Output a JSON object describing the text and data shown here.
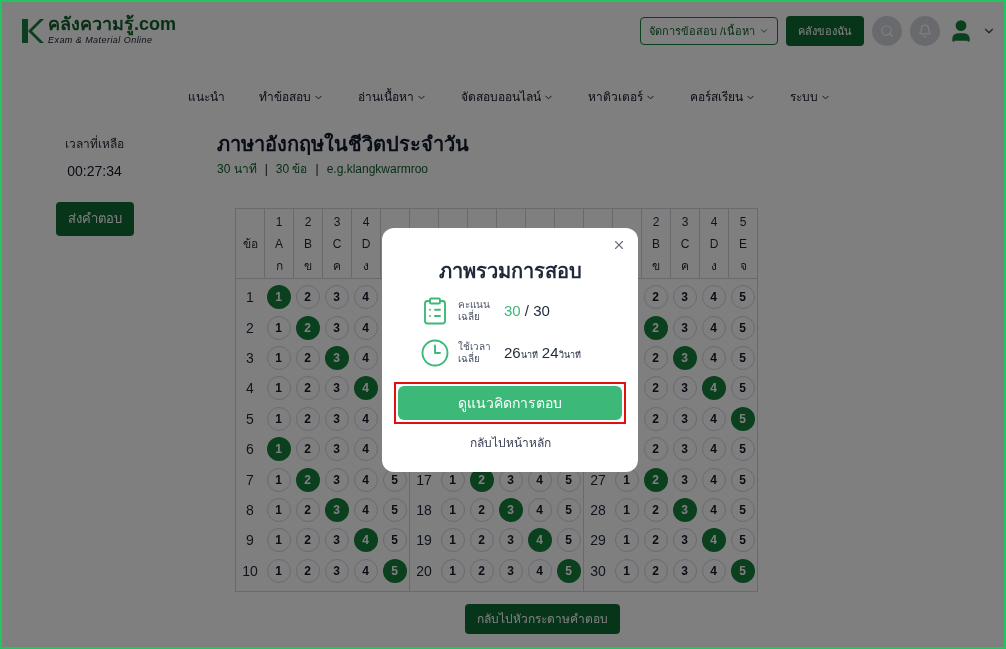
{
  "header": {
    "logo_title": "คลังความรู้.com",
    "logo_subtitle": "Exam & Material Online",
    "manage_menu": "จัดการข้อสอบ /เนื้อหา",
    "my_button": "คลังของฉัน"
  },
  "nav": [
    {
      "label": "แนะนำ",
      "dropdown": false
    },
    {
      "label": "ทำข้อสอบ",
      "dropdown": true
    },
    {
      "label": "อ่านเนื้อหา",
      "dropdown": true
    },
    {
      "label": "จัดสอบออนไลน์",
      "dropdown": true
    },
    {
      "label": "หาติวเตอร์",
      "dropdown": true
    },
    {
      "label": "คอร์สเรียน",
      "dropdown": true
    },
    {
      "label": "ระบบ",
      "dropdown": true
    }
  ],
  "timer": {
    "label": "เวลาที่เหลือ",
    "value": "00:27:34",
    "submit": "ส่งคำตอบ"
  },
  "exam": {
    "title": "ภาษาอังกฤษในชีวิตประจำวัน",
    "meta": [
      "30 นาที",
      "30 ข้อ",
      "e.g.klangkwarmroo"
    ],
    "separator": "|"
  },
  "sheet": {
    "groups": [
      {
        "label": "ข้อ",
        "kind": "left",
        "columns": [
          {
            "number": "1",
            "letter": "A",
            "thai": "ก"
          },
          {
            "number": "2",
            "letter": "B",
            "thai": "ข"
          },
          {
            "number": "3",
            "letter": "C",
            "thai": "ค"
          },
          {
            "number": "4",
            "letter": "D",
            "thai": "ง"
          }
        ],
        "rows": [
          {
            "number": "1",
            "choices": [
              {
                "label": "1",
                "selected": true
              },
              {
                "label": "2",
                "selected": false
              },
              {
                "label": "3",
                "selected": false
              },
              {
                "label": "4",
                "selected": false
              }
            ]
          },
          {
            "number": "2",
            "choices": [
              {
                "label": "1",
                "selected": false
              },
              {
                "label": "2",
                "selected": true
              },
              {
                "label": "3",
                "selected": false
              },
              {
                "label": "4",
                "selected": false
              }
            ]
          },
          {
            "number": "3",
            "choices": [
              {
                "label": "1",
                "selected": false
              },
              {
                "label": "2",
                "selected": false
              },
              {
                "label": "3",
                "selected": true
              },
              {
                "label": "4",
                "selected": false
              }
            ]
          },
          {
            "number": "4",
            "choices": [
              {
                "label": "1",
                "selected": false
              },
              {
                "label": "2",
                "selected": false
              },
              {
                "label": "3",
                "selected": false
              },
              {
                "label": "4",
                "selected": true
              }
            ]
          },
          {
            "number": "5",
            "choices": [
              {
                "label": "1",
                "selected": false
              },
              {
                "label": "2",
                "selected": false
              },
              {
                "label": "3",
                "selected": false
              },
              {
                "label": "4",
                "selected": false
              }
            ]
          },
          {
            "number": "6",
            "choices": [
              {
                "label": "1",
                "selected": true
              },
              {
                "label": "2",
                "selected": false
              },
              {
                "label": "3",
                "selected": false
              },
              {
                "label": "4",
                "selected": false
              }
            ]
          },
          {
            "number": "7",
            "choices": [
              {
                "label": "1",
                "selected": false
              },
              {
                "label": "2",
                "selected": true
              },
              {
                "label": "3",
                "selected": false
              },
              {
                "label": "4",
                "selected": false
              },
              {
                "label": "5",
                "selected": false
              }
            ]
          },
          {
            "number": "8",
            "choices": [
              {
                "label": "1",
                "selected": false
              },
              {
                "label": "2",
                "selected": false
              },
              {
                "label": "3",
                "selected": true
              },
              {
                "label": "4",
                "selected": false
              },
              {
                "label": "5",
                "selected": false
              }
            ]
          },
          {
            "number": "9",
            "choices": [
              {
                "label": "1",
                "selected": false
              },
              {
                "label": "2",
                "selected": false
              },
              {
                "label": "3",
                "selected": false
              },
              {
                "label": "4",
                "selected": true
              },
              {
                "label": "5",
                "selected": false
              }
            ]
          },
          {
            "number": "10",
            "choices": [
              {
                "label": "1",
                "selected": false
              },
              {
                "label": "2",
                "selected": false
              },
              {
                "label": "3",
                "selected": false
              },
              {
                "label": "4",
                "selected": false
              },
              {
                "label": "5",
                "selected": true
              }
            ]
          }
        ]
      },
      {
        "kind": "bottom",
        "rows": [
          {
            "number": "17",
            "choices": [
              {
                "label": "1",
                "selected": false
              },
              {
                "label": "2",
                "selected": true
              },
              {
                "label": "3",
                "selected": false
              },
              {
                "label": "4",
                "selected": false
              },
              {
                "label": "5",
                "selected": false
              }
            ]
          },
          {
            "number": "18",
            "choices": [
              {
                "label": "1",
                "selected": false
              },
              {
                "label": "2",
                "selected": false
              },
              {
                "label": "3",
                "selected": true
              },
              {
                "label": "4",
                "selected": false
              },
              {
                "label": "5",
                "selected": false
              }
            ]
          },
          {
            "number": "19",
            "choices": [
              {
                "label": "1",
                "selected": false
              },
              {
                "label": "2",
                "selected": false
              },
              {
                "label": "3",
                "selected": false
              },
              {
                "label": "4",
                "selected": true
              },
              {
                "label": "5",
                "selected": false
              }
            ]
          },
          {
            "number": "20",
            "choices": [
              {
                "label": "1",
                "selected": false
              },
              {
                "label": "2",
                "selected": false
              },
              {
                "label": "3",
                "selected": false
              },
              {
                "label": "4",
                "selected": false
              },
              {
                "label": "5",
                "selected": true
              }
            ]
          }
        ]
      },
      {
        "kind": "right",
        "columns": [
          {
            "number": "2",
            "letter": "B",
            "thai": "ข"
          },
          {
            "number": "3",
            "letter": "C",
            "thai": "ค"
          },
          {
            "number": "4",
            "letter": "D",
            "thai": "ง"
          },
          {
            "number": "5",
            "letter": "E",
            "thai": "จ"
          }
        ],
        "rows": [
          {
            "choices": [
              {
                "label": "2",
                "selected": false
              },
              {
                "label": "3",
                "selected": false
              },
              {
                "label": "4",
                "selected": false
              },
              {
                "label": "5",
                "selected": false
              }
            ]
          },
          {
            "choices": [
              {
                "label": "2",
                "selected": true
              },
              {
                "label": "3",
                "selected": false
              },
              {
                "label": "4",
                "selected": false
              },
              {
                "label": "5",
                "selected": false
              }
            ]
          },
          {
            "choices": [
              {
                "label": "2",
                "selected": false
              },
              {
                "label": "3",
                "selected": true
              },
              {
                "label": "4",
                "selected": false
              },
              {
                "label": "5",
                "selected": false
              }
            ]
          },
          {
            "choices": [
              {
                "label": "2",
                "selected": false
              },
              {
                "label": "3",
                "selected": false
              },
              {
                "label": "4",
                "selected": true
              },
              {
                "label": "5",
                "selected": false
              }
            ]
          },
          {
            "choices": [
              {
                "label": "2",
                "selected": false
              },
              {
                "label": "3",
                "selected": false
              },
              {
                "label": "4",
                "selected": false
              },
              {
                "label": "5",
                "selected": true
              }
            ]
          },
          {
            "choices": [
              {
                "label": "2",
                "selected": false
              },
              {
                "label": "3",
                "selected": false
              },
              {
                "label": "4",
                "selected": false
              },
              {
                "label": "5",
                "selected": false
              }
            ]
          },
          {
            "number": "27",
            "choices": [
              {
                "label": "1",
                "selected": false
              },
              {
                "label": "2",
                "selected": true
              },
              {
                "label": "3",
                "selected": false
              },
              {
                "label": "4",
                "selected": false
              },
              {
                "label": "5",
                "selected": false
              }
            ]
          },
          {
            "number": "28",
            "choices": [
              {
                "label": "1",
                "selected": false
              },
              {
                "label": "2",
                "selected": false
              },
              {
                "label": "3",
                "selected": true
              },
              {
                "label": "4",
                "selected": false
              },
              {
                "label": "5",
                "selected": false
              }
            ]
          },
          {
            "number": "29",
            "choices": [
              {
                "label": "1",
                "selected": false
              },
              {
                "label": "2",
                "selected": false
              },
              {
                "label": "3",
                "selected": false
              },
              {
                "label": "4",
                "selected": true
              },
              {
                "label": "5",
                "selected": false
              }
            ]
          },
          {
            "number": "30",
            "choices": [
              {
                "label": "1",
                "selected": false
              },
              {
                "label": "2",
                "selected": false
              },
              {
                "label": "3",
                "selected": false
              },
              {
                "label": "4",
                "selected": false
              },
              {
                "label": "5",
                "selected": true
              }
            ]
          }
        ]
      }
    ],
    "back_button": "กลับไปหัวกระดาษคำตอบ"
  },
  "modal": {
    "title": "ภาพรวมการสอบ",
    "score": {
      "label": "คะแนน\nเฉลี่ย",
      "value": "30",
      "total": "/ 30"
    },
    "time": {
      "label": "ใช้เวลา\nเฉลี่ย",
      "minutes": "26",
      "minutes_unit": "นาที",
      "seconds": "24",
      "seconds_unit": "วินาที"
    },
    "primary_button": {
      "label": "ดูแนวคิดการตอบ",
      "highlighted": true
    },
    "secondary_link": "กลับไปหน้าหลัก"
  }
}
